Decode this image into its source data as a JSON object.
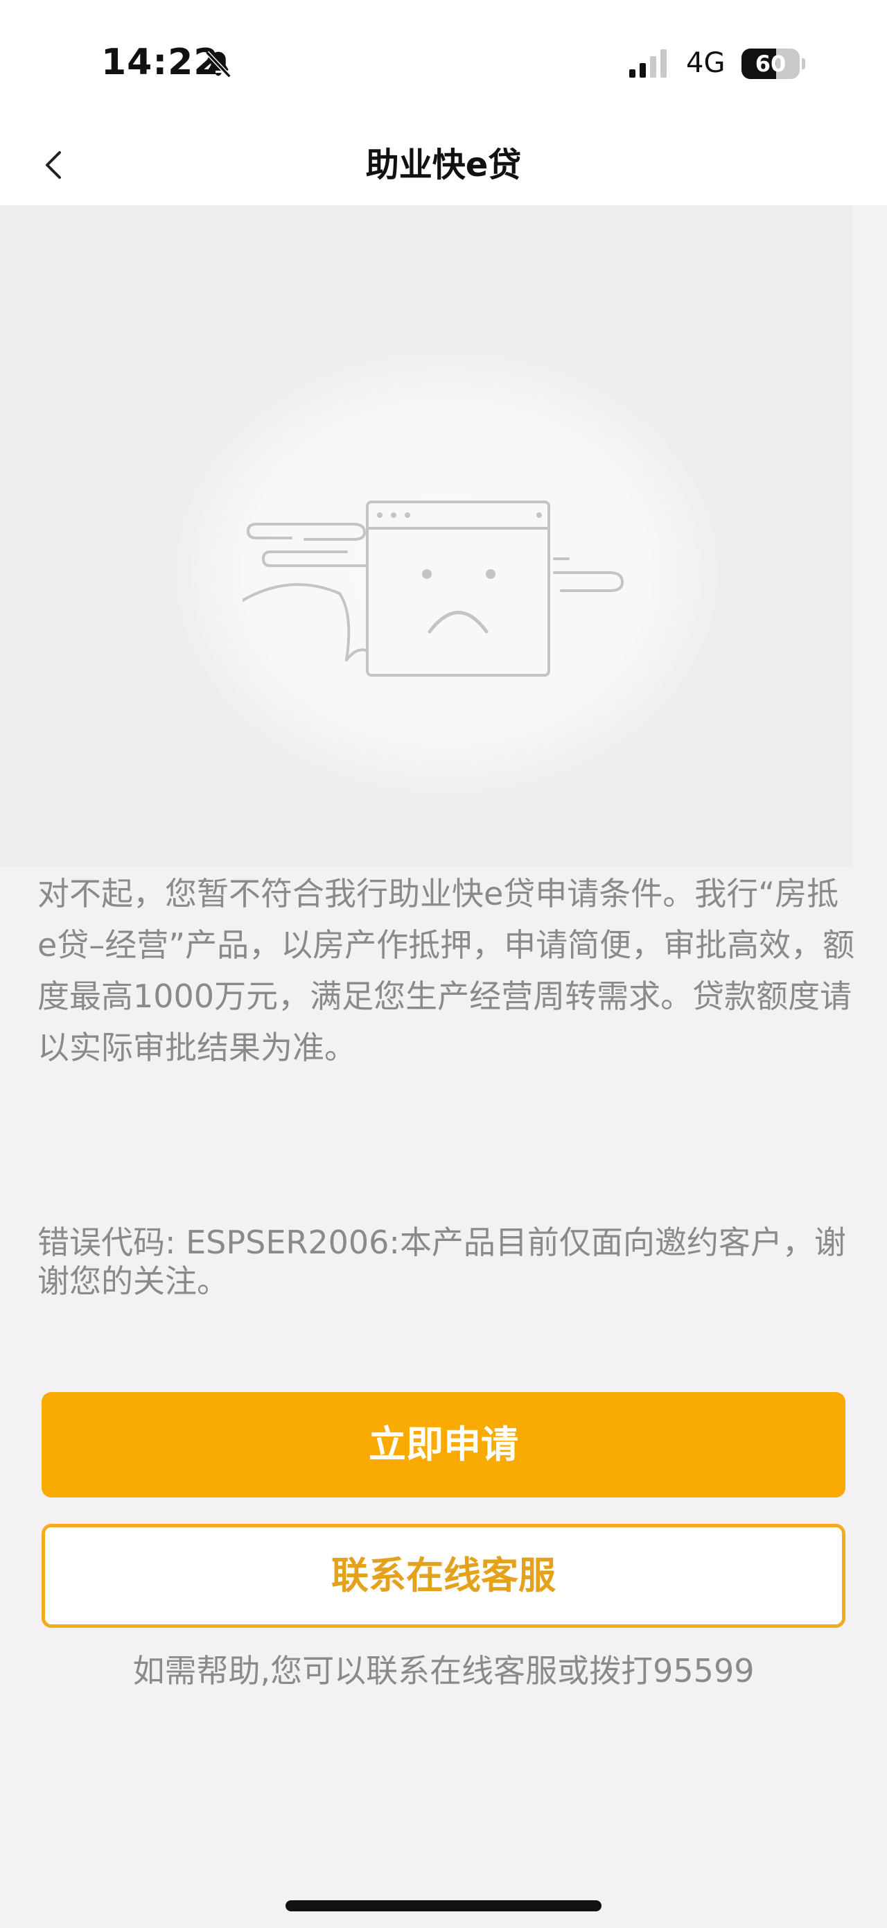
{
  "status_bar": {
    "time": "14:22",
    "network": "4G",
    "battery": "60",
    "battery_level": 0.6,
    "icons": [
      "bell-muted-icon",
      "signal-icon",
      "battery-icon"
    ]
  },
  "nav": {
    "title": "助业快e贷",
    "back_icon": "chevron-left-icon"
  },
  "hero": {
    "illustration": "sad-browser-window-with-clouds"
  },
  "content": {
    "notice": "对不起，您暂不符合我行助业快e贷申请条件。我行“房抵e贷–经营”产品，以房产作抵押，申请简便，审批高效，额度最高1000万元，满足您生产经营周转需求。贷款额度请以实际审批结果为准。",
    "error": "错误代码: ESPSER2006:本产品目前仅面向邀约客户，谢谢您的关注。",
    "apply_label": "立即申请",
    "service_label": "联系在线客服",
    "help": "如需帮助,您可以联系在线客服或拨打95599"
  },
  "colors": {
    "accent": "#faab03",
    "outline_accent": "#f3ad1c",
    "muted_text": "#8a8a8a",
    "background": "#f4f1f5"
  }
}
